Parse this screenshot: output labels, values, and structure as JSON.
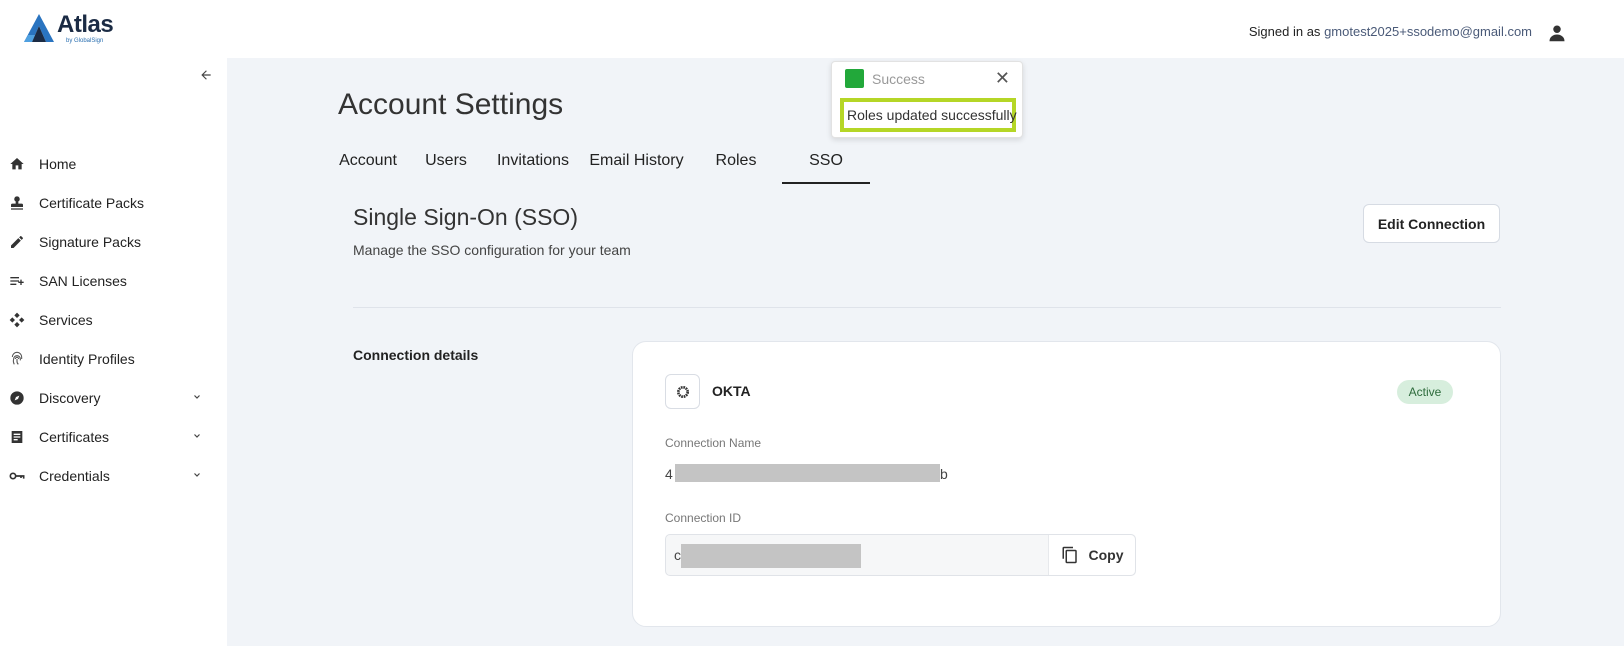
{
  "header": {
    "logo_text": "Atlas",
    "logo_sub": "by GlobalSign",
    "signed_prefix": "Signed in as",
    "email": "gmotest2025+ssodemo@gmail.com"
  },
  "sidebar": {
    "items": [
      {
        "label": "Home",
        "icon": "home-icon"
      },
      {
        "label": "Certificate Packs",
        "icon": "stamp-icon"
      },
      {
        "label": "Signature Packs",
        "icon": "pen-icon"
      },
      {
        "label": "SAN Licenses",
        "icon": "playlist-add-icon"
      },
      {
        "label": "Services",
        "icon": "services-icon"
      },
      {
        "label": "Identity Profiles",
        "icon": "fingerprint-icon"
      },
      {
        "label": "Discovery",
        "icon": "compass-icon",
        "expandable": true
      },
      {
        "label": "Certificates",
        "icon": "document-icon",
        "expandable": true
      },
      {
        "label": "Credentials",
        "icon": "key-icon",
        "expandable": true
      }
    ]
  },
  "page": {
    "title": "Account Settings",
    "tabs": [
      "Account",
      "Users",
      "Invitations",
      "Email History",
      "Roles",
      "SSO"
    ],
    "active_tab": "SSO"
  },
  "sso": {
    "title": "Single Sign-On (SSO)",
    "subtitle": "Manage the SSO configuration for your team",
    "edit_button": "Edit Connection",
    "connection_details_label": "Connection details",
    "provider": "OKTA",
    "status": "Active",
    "connection_name_label": "Connection Name",
    "connection_name_start": "4",
    "connection_name_end": "b",
    "connection_id_label": "Connection ID",
    "connection_id_start": "c",
    "copy_label": "Copy"
  },
  "toast": {
    "title": "Success",
    "message": "Roles updated successfully"
  },
  "colors": {
    "success": "#22a83a",
    "highlight": "#b5d626",
    "active_badge_bg": "#d7eedd",
    "main_bg": "#f1f4f8"
  }
}
